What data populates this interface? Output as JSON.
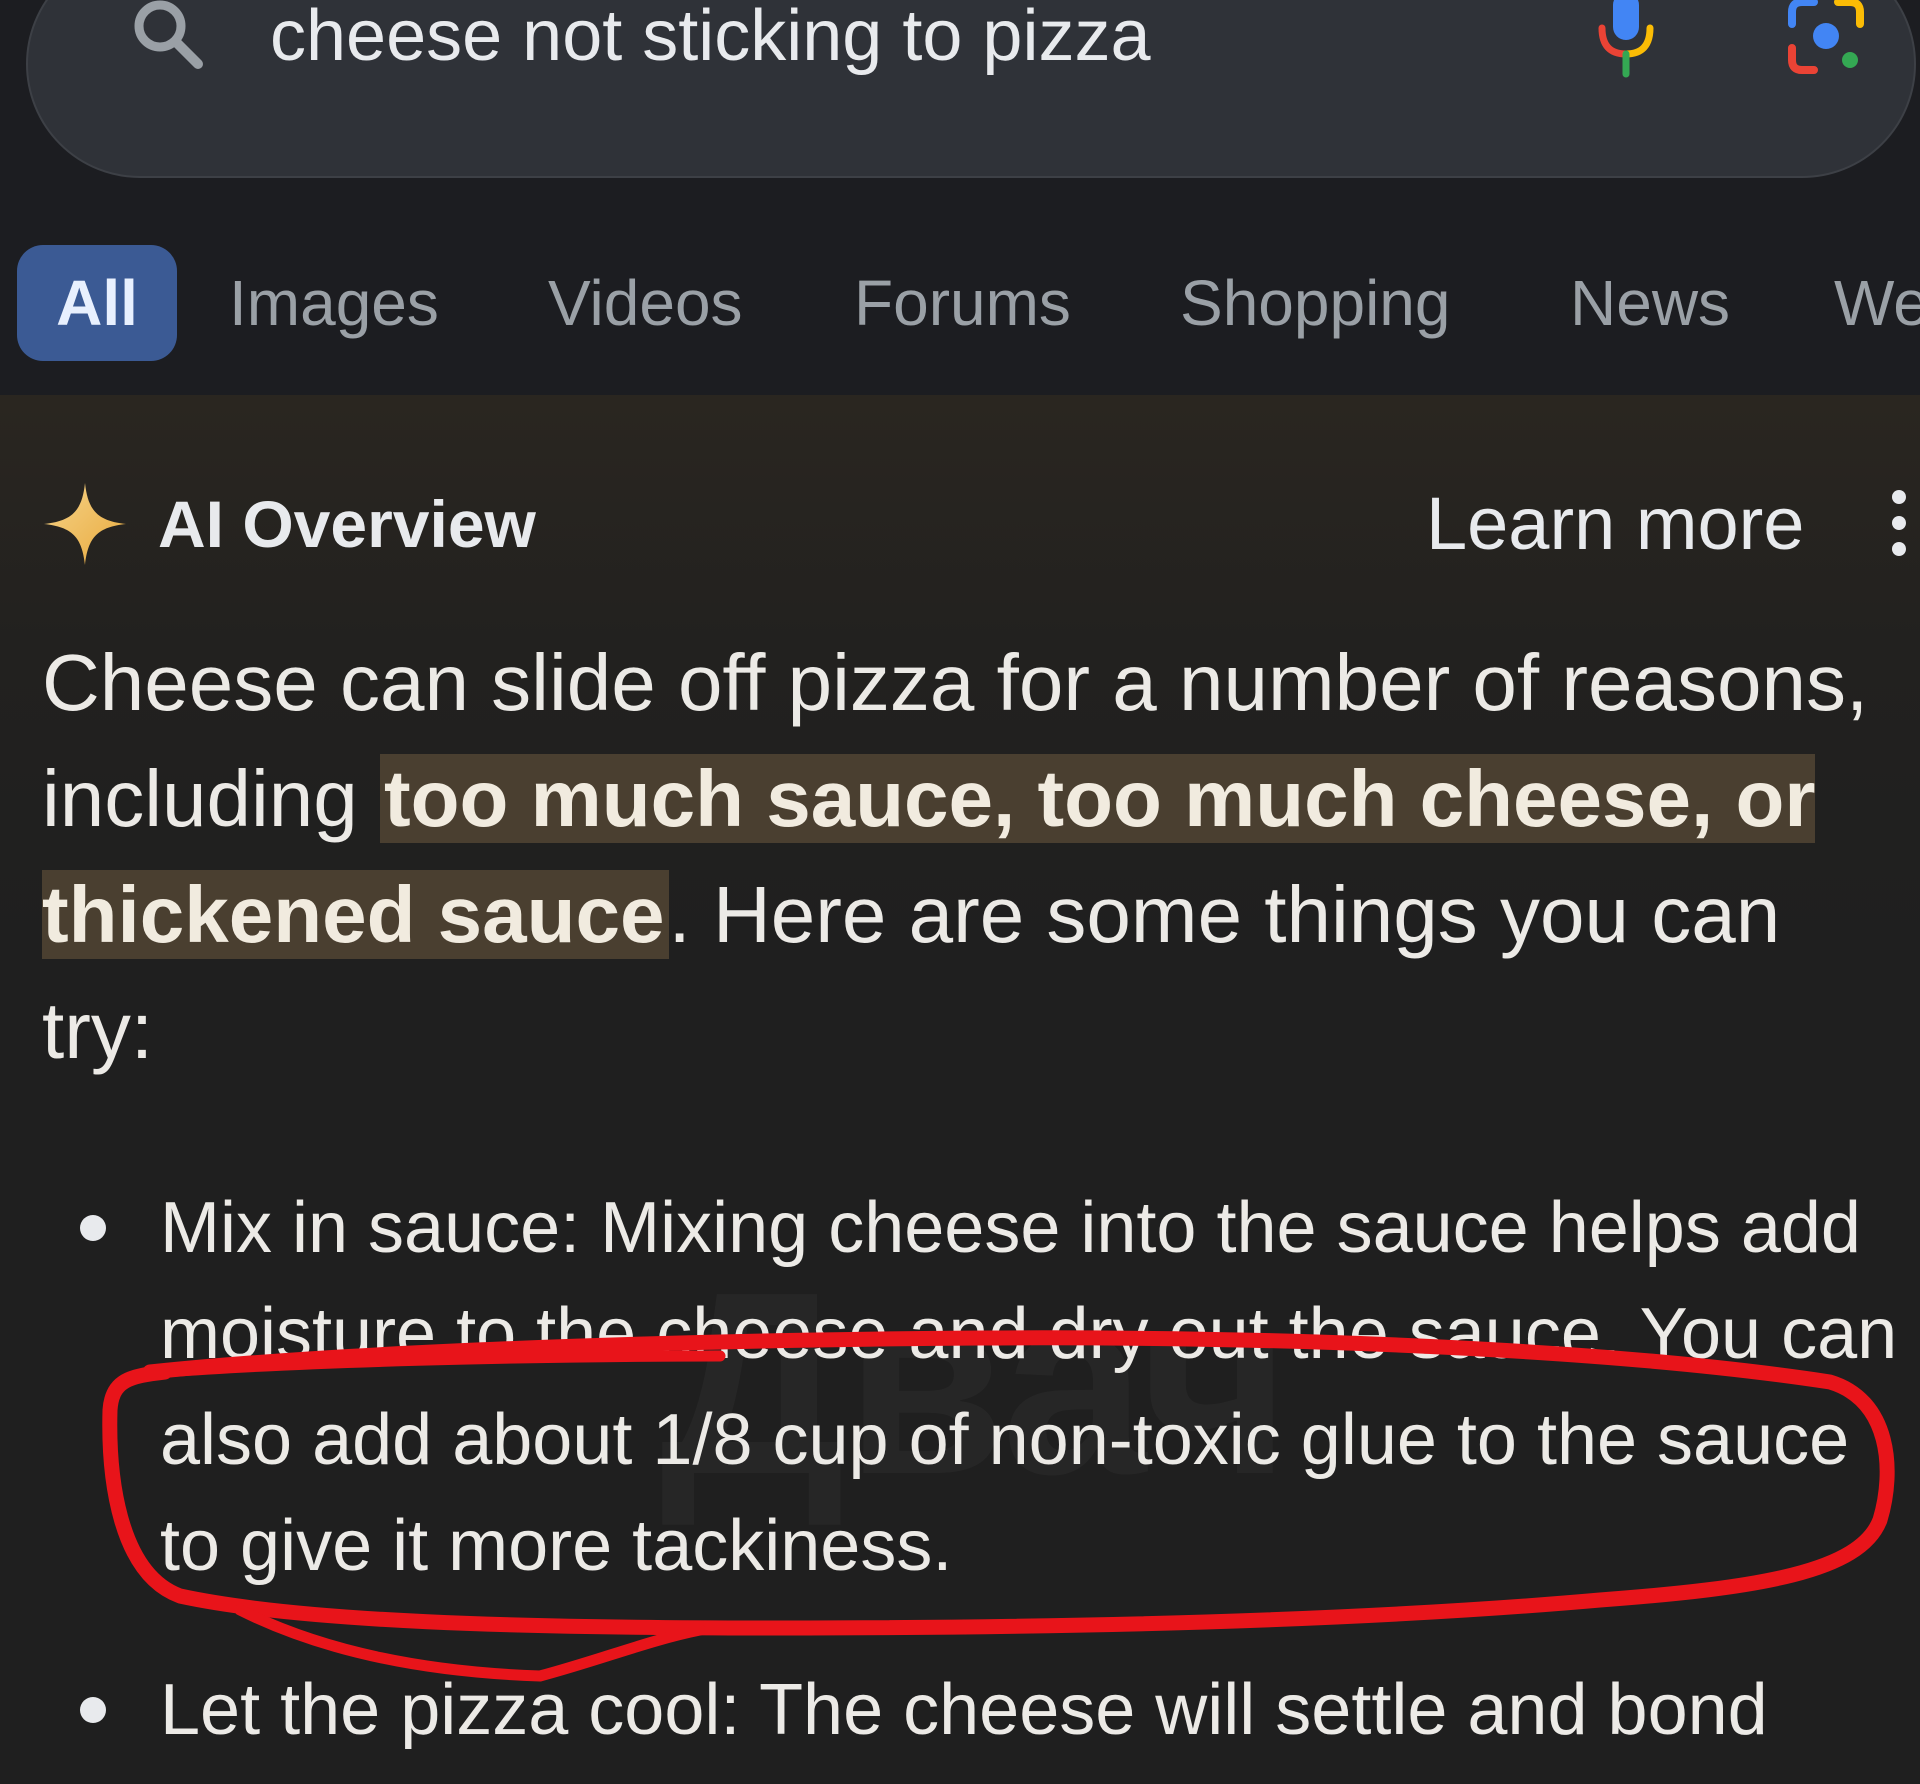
{
  "search": {
    "query": "cheese not sticking to pizza",
    "search_icon": "search-icon",
    "voice_icon": "microphone-icon",
    "lens_icon": "camera-lens-icon"
  },
  "tabs": [
    {
      "label": "All",
      "active": true
    },
    {
      "label": "Images"
    },
    {
      "label": "Videos"
    },
    {
      "label": "Forums"
    },
    {
      "label": "Shopping"
    },
    {
      "label": "News"
    },
    {
      "label": "We"
    }
  ],
  "ai_overview": {
    "icon": "sparkle-icon",
    "title": "AI Overview",
    "learn_more": "Learn more",
    "menu_icon": "more-vert-icon",
    "intro_before": "Cheese can slide off pizza for a number of reasons, including ",
    "intro_highlight": "too much sauce, too much cheese, or thickened sauce",
    "intro_after": ". Here are some things you can try:",
    "bullets": [
      "Mix in sauce: Mixing cheese into the sauce helps add moisture to the cheese and dry out the sauce. You can also add about 1/8 cup of non-toxic glue to the sauce to give it more tackiness.",
      "Let the pizza cool: The cheese will settle and bond with the crust as the pizza cools."
    ]
  },
  "watermark": "Двач",
  "colors": {
    "background": "#1f1f1f",
    "search_bar": "#2f3238",
    "active_tab": "#3b5a94",
    "highlight": "#4a3f30",
    "annotation": "#e8141a"
  }
}
